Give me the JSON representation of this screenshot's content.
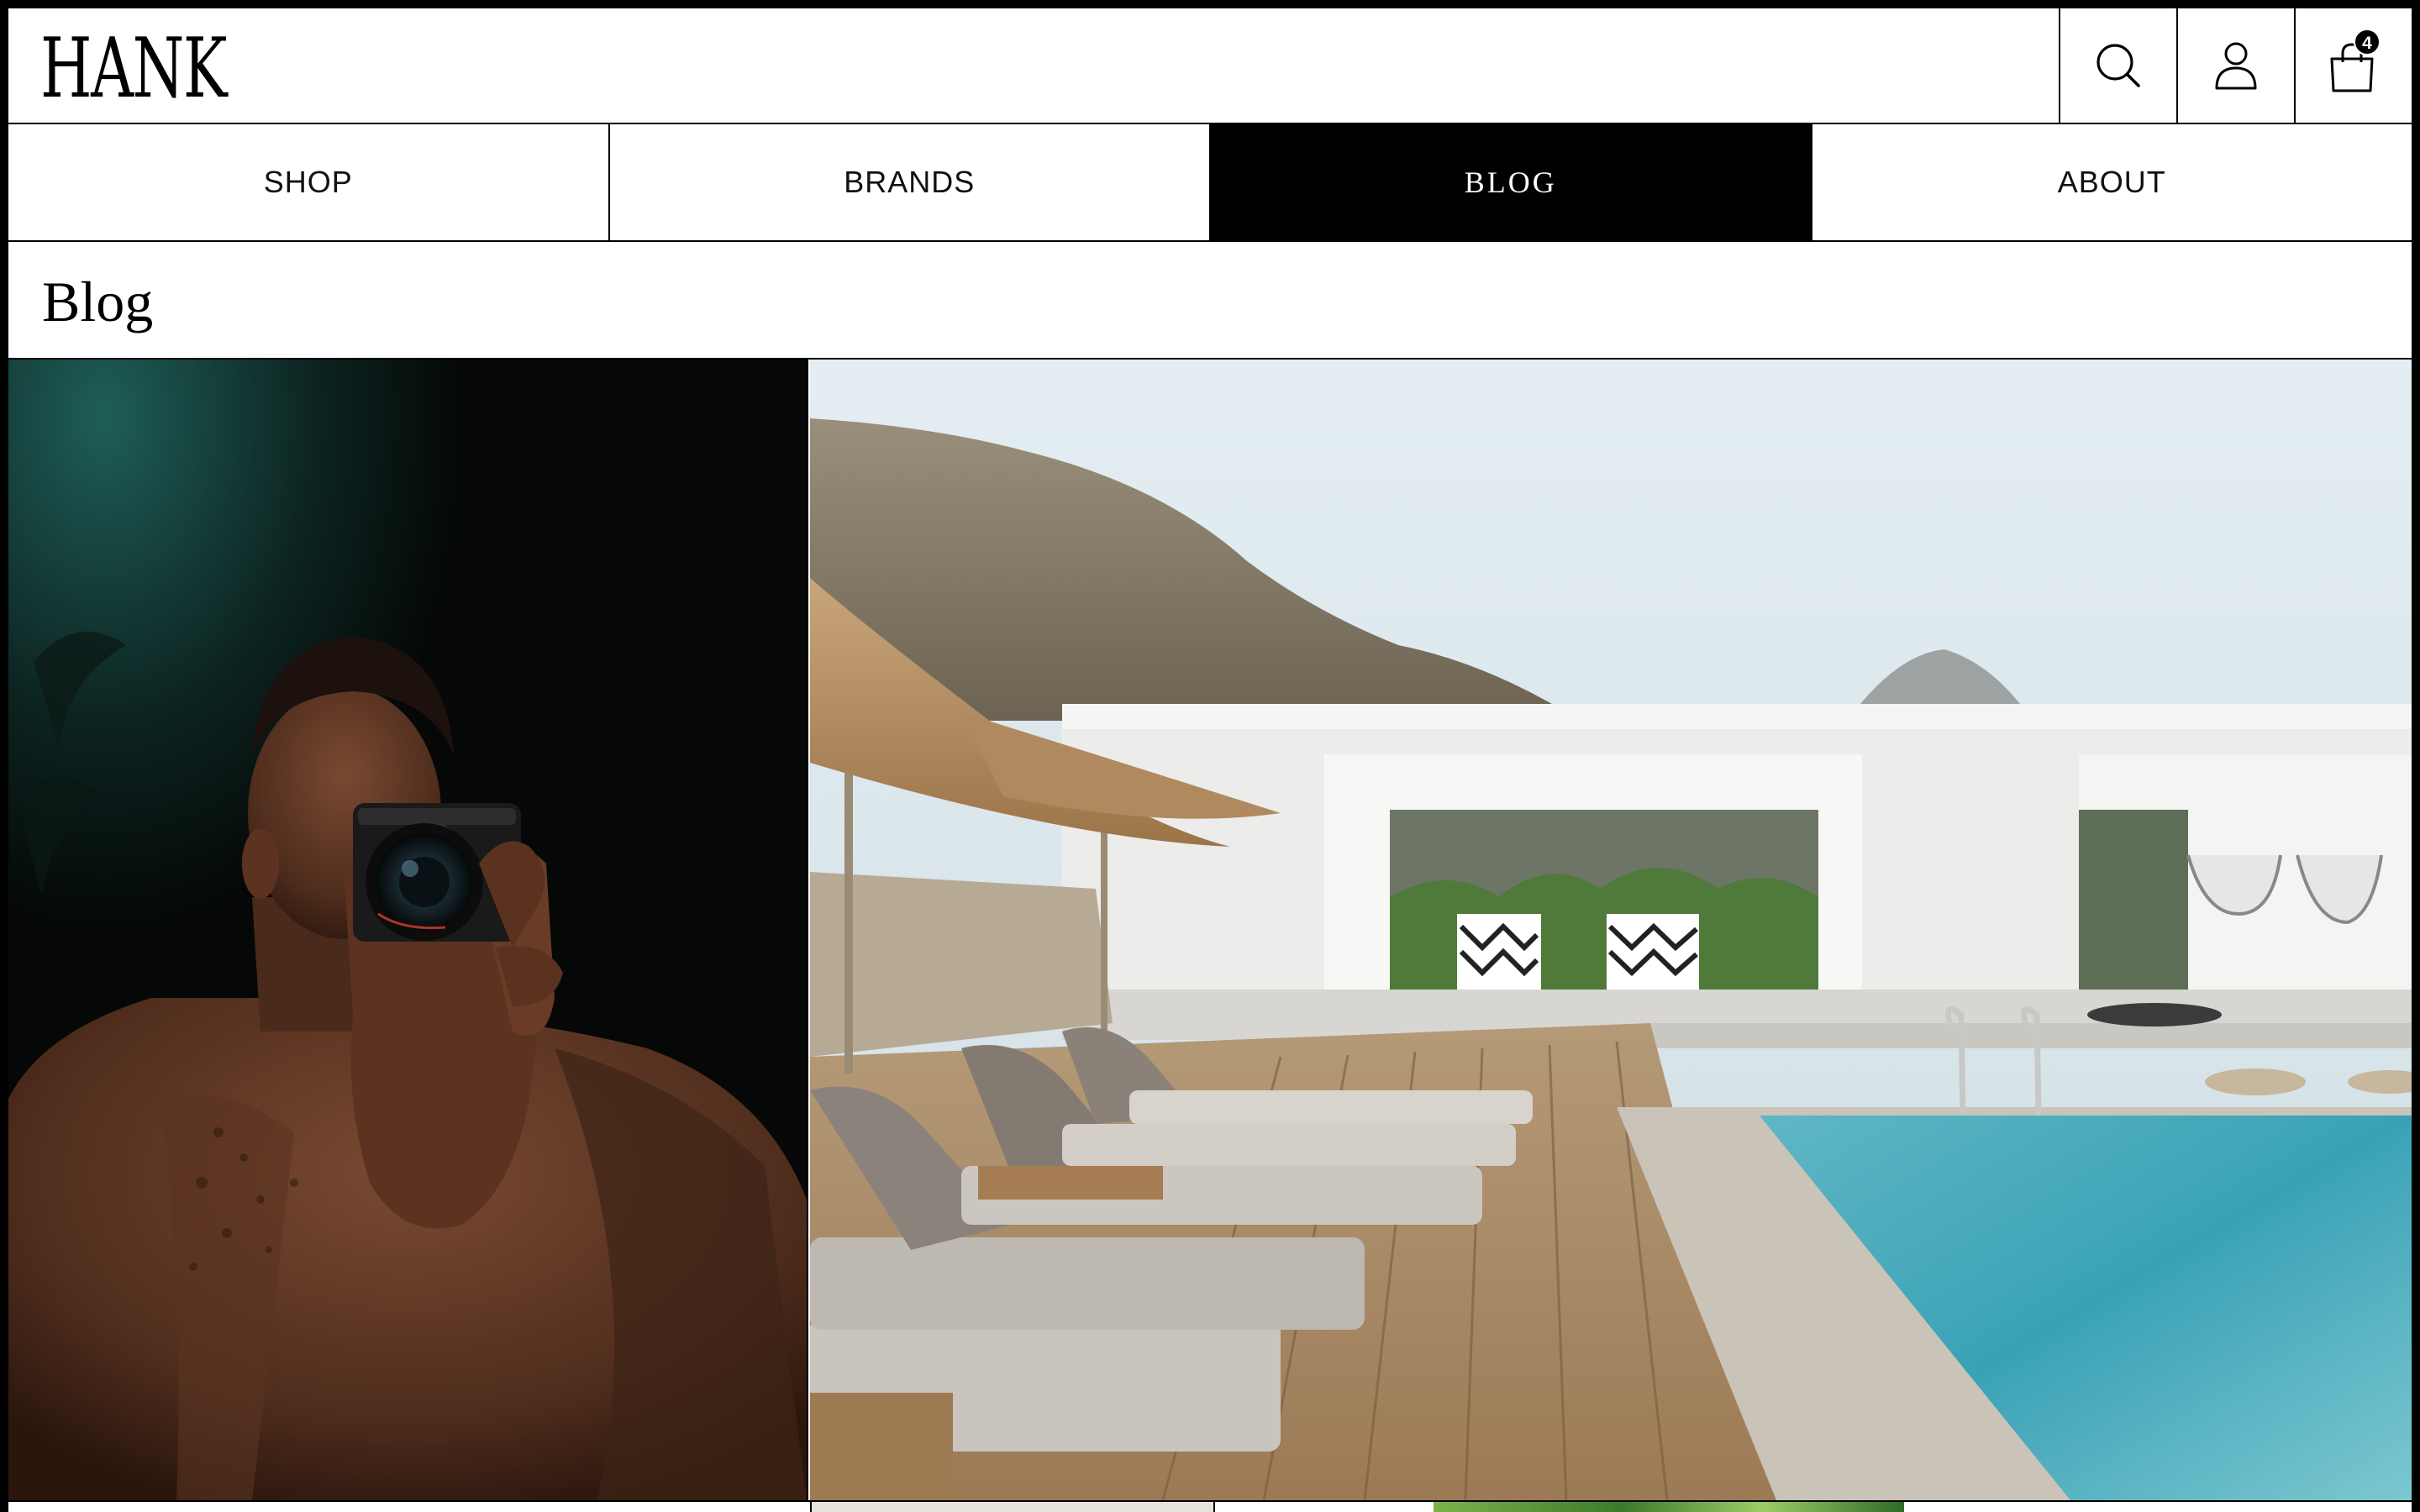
{
  "header": {
    "logo": "HANK",
    "search_icon": "search-icon",
    "account_icon": "user-icon",
    "cart_icon": "shopping-bag-icon",
    "cart_count": "4"
  },
  "nav": {
    "tabs": [
      {
        "label": "SHOP",
        "active": false
      },
      {
        "label": "BRANDS",
        "active": false
      },
      {
        "label": "BLOG",
        "active": true
      },
      {
        "label": "ABOUT",
        "active": false
      }
    ]
  },
  "page": {
    "title": "Blog"
  },
  "colors": {
    "accent": "#000000",
    "background": "#ffffff",
    "active_tab_text": "#ffffff"
  }
}
